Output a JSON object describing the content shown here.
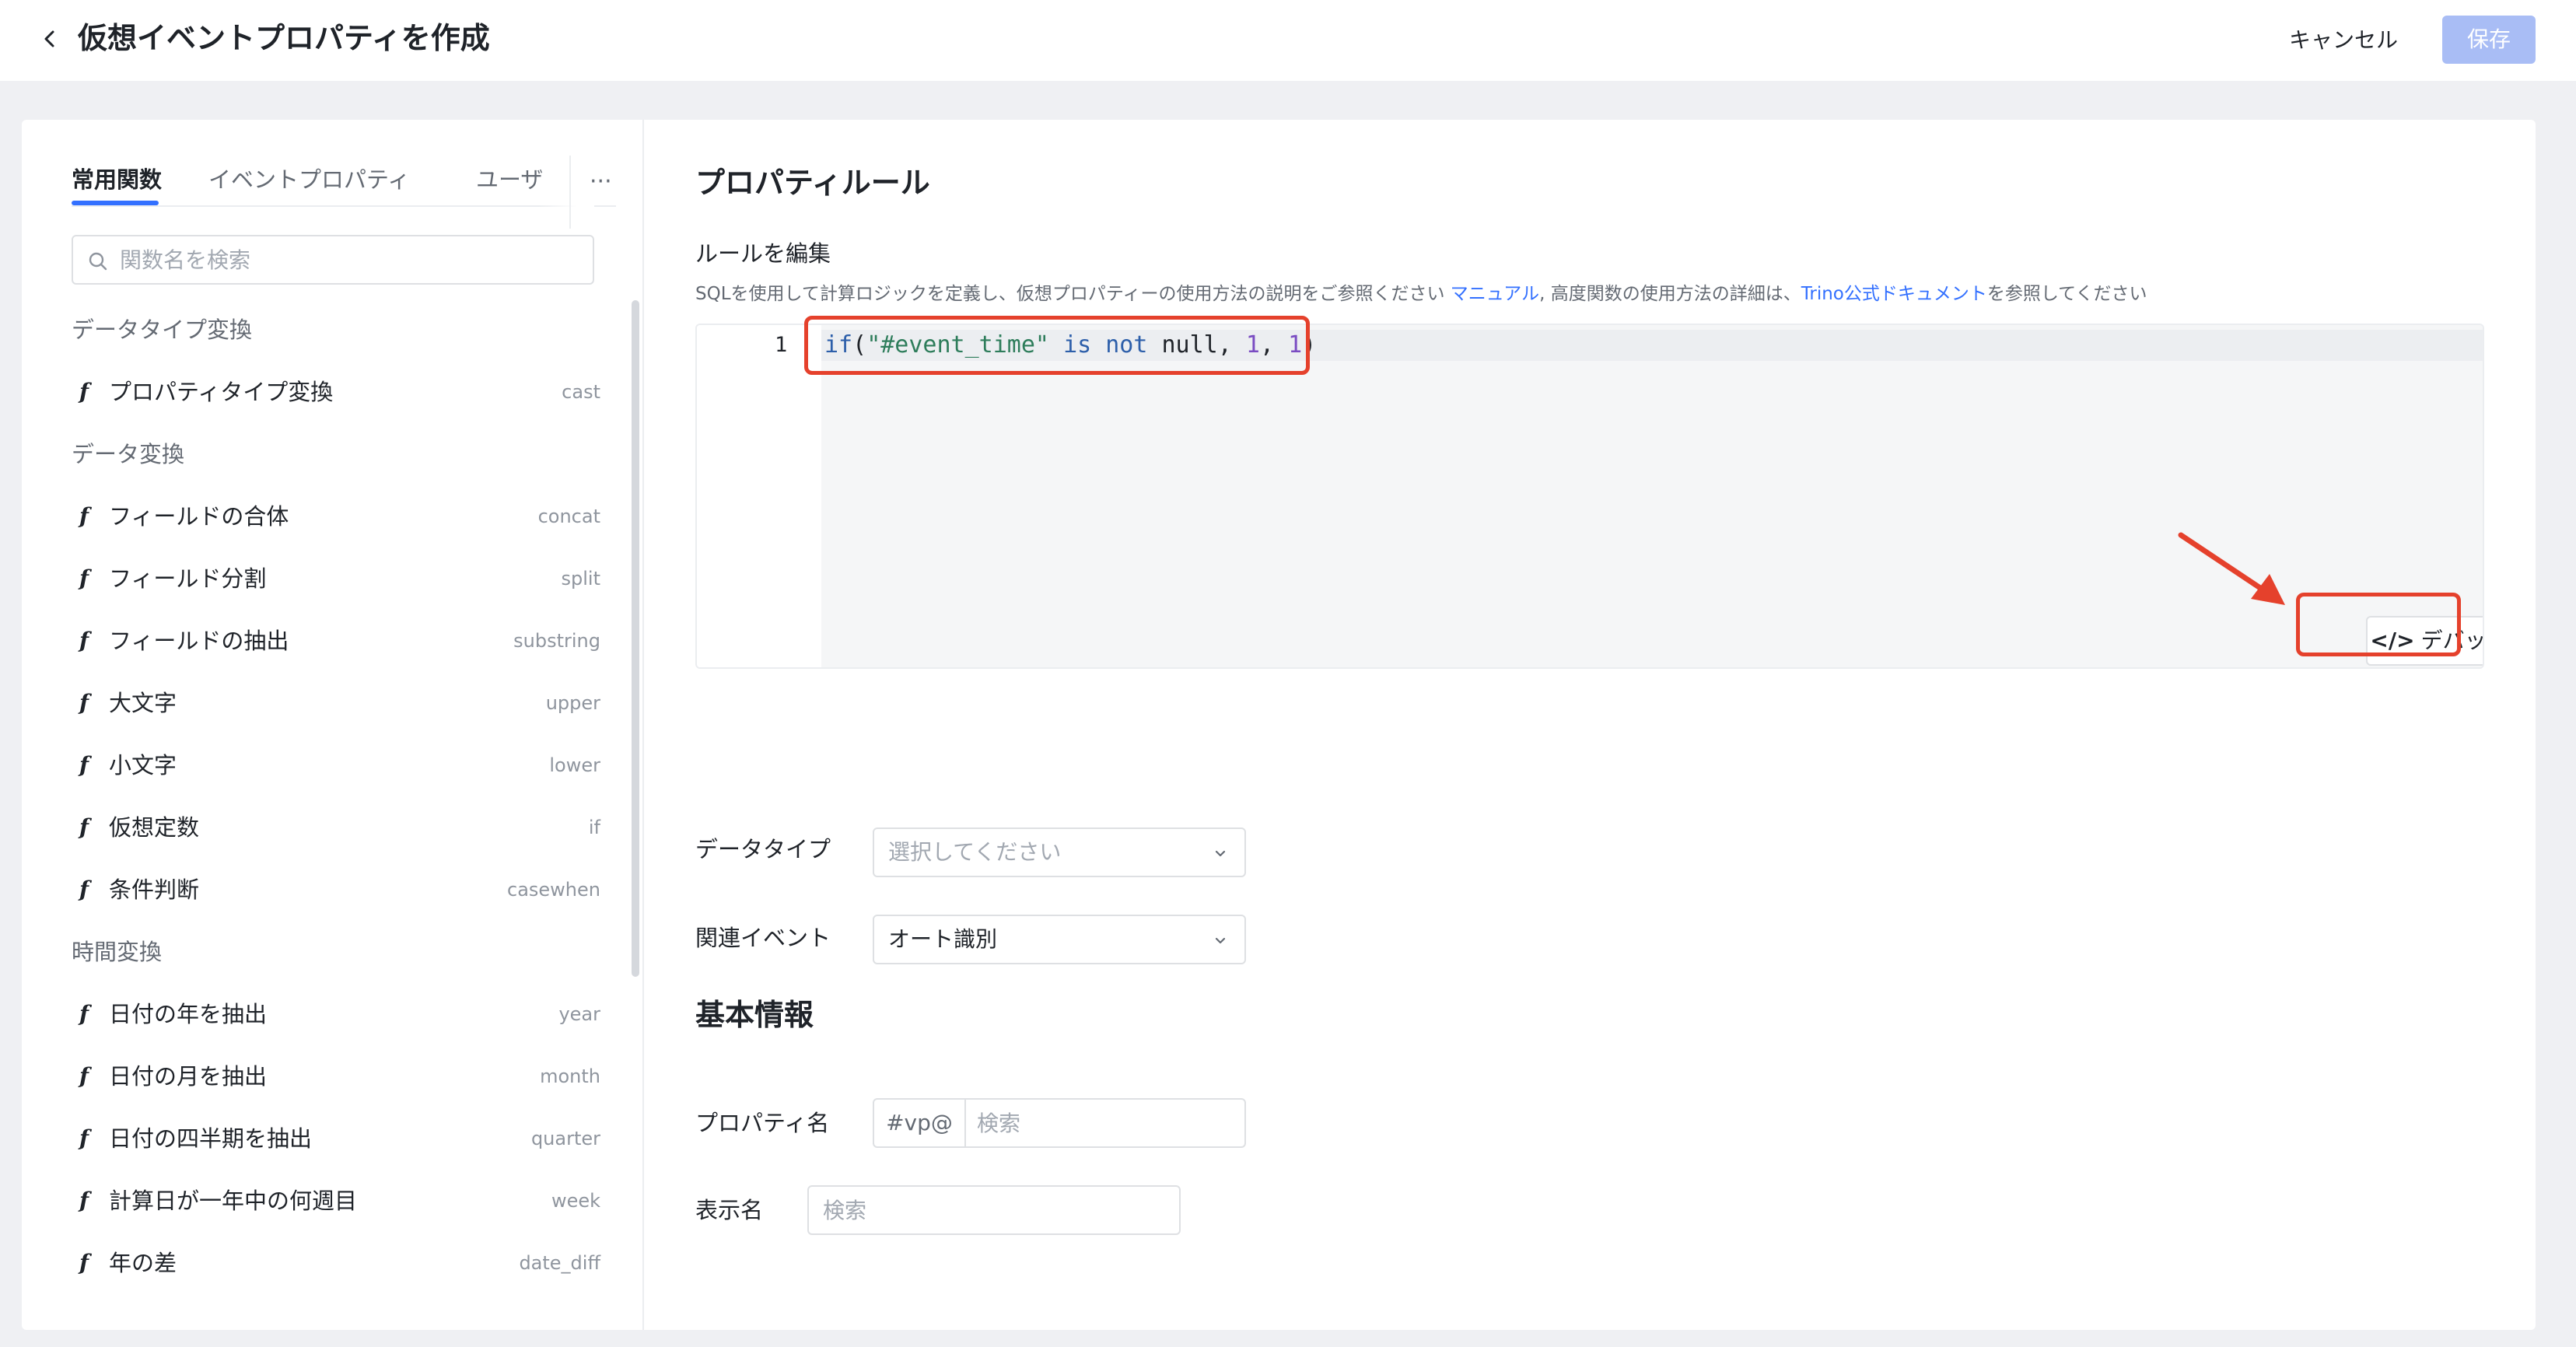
{
  "header": {
    "title": "仮想イベントプロパティを作成",
    "cancel_label": "キャンセル",
    "save_label": "保存"
  },
  "left": {
    "tabs": [
      {
        "label": "常用関数",
        "active": true
      },
      {
        "label": "イベントプロパティ",
        "active": false
      },
      {
        "label": "ユーザ",
        "active": false
      }
    ],
    "more_label": "···",
    "search_placeholder": "関数名を検索",
    "groups": [
      {
        "title": "データタイプ変換",
        "items": [
          {
            "name": "プロパティタイプ変換",
            "code": "cast"
          }
        ]
      },
      {
        "title": "データ変換",
        "items": [
          {
            "name": "フィールドの合体",
            "code": "concat"
          },
          {
            "name": "フィールド分割",
            "code": "split"
          },
          {
            "name": "フィールドの抽出",
            "code": "substring"
          },
          {
            "name": "大文字",
            "code": "upper"
          },
          {
            "name": "小文字",
            "code": "lower"
          },
          {
            "name": "仮想定数",
            "code": "if"
          },
          {
            "name": "条件判断",
            "code": "casewhen"
          }
        ]
      },
      {
        "title": "時間変換",
        "items": [
          {
            "name": "日付の年を抽出",
            "code": "year"
          },
          {
            "name": "日付の月を抽出",
            "code": "month"
          },
          {
            "name": "日付の四半期を抽出",
            "code": "quarter"
          },
          {
            "name": "計算日が一年中の何週目",
            "code": "week"
          },
          {
            "name": "年の差",
            "code": "date_diff"
          }
        ]
      }
    ],
    "fn_marker": "f"
  },
  "right": {
    "rule_title": "プロパティルール",
    "edit_label": "ルールを編集",
    "desc_prefix": "SQLを使用して計算ロジックを定義し、仮想プロパティーの使用方法の説明をご参照ください",
    "desc_link1": "マニュアル",
    "desc_middle": ", 高度関数の使用方法の詳細は、",
    "desc_link2": "Trino公式ドキュメント",
    "desc_suffix": "を参照してください",
    "editor": {
      "line_number": "1",
      "code_tokens": [
        {
          "t": "if",
          "c": "kw"
        },
        {
          "t": "(",
          "c": ""
        },
        {
          "t": "\"#event_time\"",
          "c": "str"
        },
        {
          "t": " ",
          "c": ""
        },
        {
          "t": "is",
          "c": "kw"
        },
        {
          "t": " ",
          "c": ""
        },
        {
          "t": "not",
          "c": "kw"
        },
        {
          "t": " null, ",
          "c": ""
        },
        {
          "t": "1",
          "c": "num"
        },
        {
          "t": ", ",
          "c": ""
        },
        {
          "t": "1",
          "c": "num"
        },
        {
          "t": ")",
          "c": ""
        }
      ],
      "debug_icon": "</>",
      "debug_label": "デバッグ"
    },
    "data_type_label": "データタイプ",
    "data_type_placeholder": "選択してください",
    "related_event_label": "関連イベント",
    "related_event_value": "オート識別",
    "basic_info_title": "基本情報",
    "property_name_label": "プロパティ名",
    "property_name_prefix": "#vp@",
    "property_name_placeholder": "検索",
    "display_name_label": "表示名",
    "display_name_placeholder": "検索"
  },
  "colors": {
    "accent": "#3370ff",
    "save_disabled": "#a9bdf5",
    "annotation_red": "#e5412c"
  },
  "icons": [
    "back-chevron-icon",
    "search-icon",
    "more-icon",
    "code-icon",
    "chevron-down-icon",
    "arrow-annotation-icon"
  ]
}
